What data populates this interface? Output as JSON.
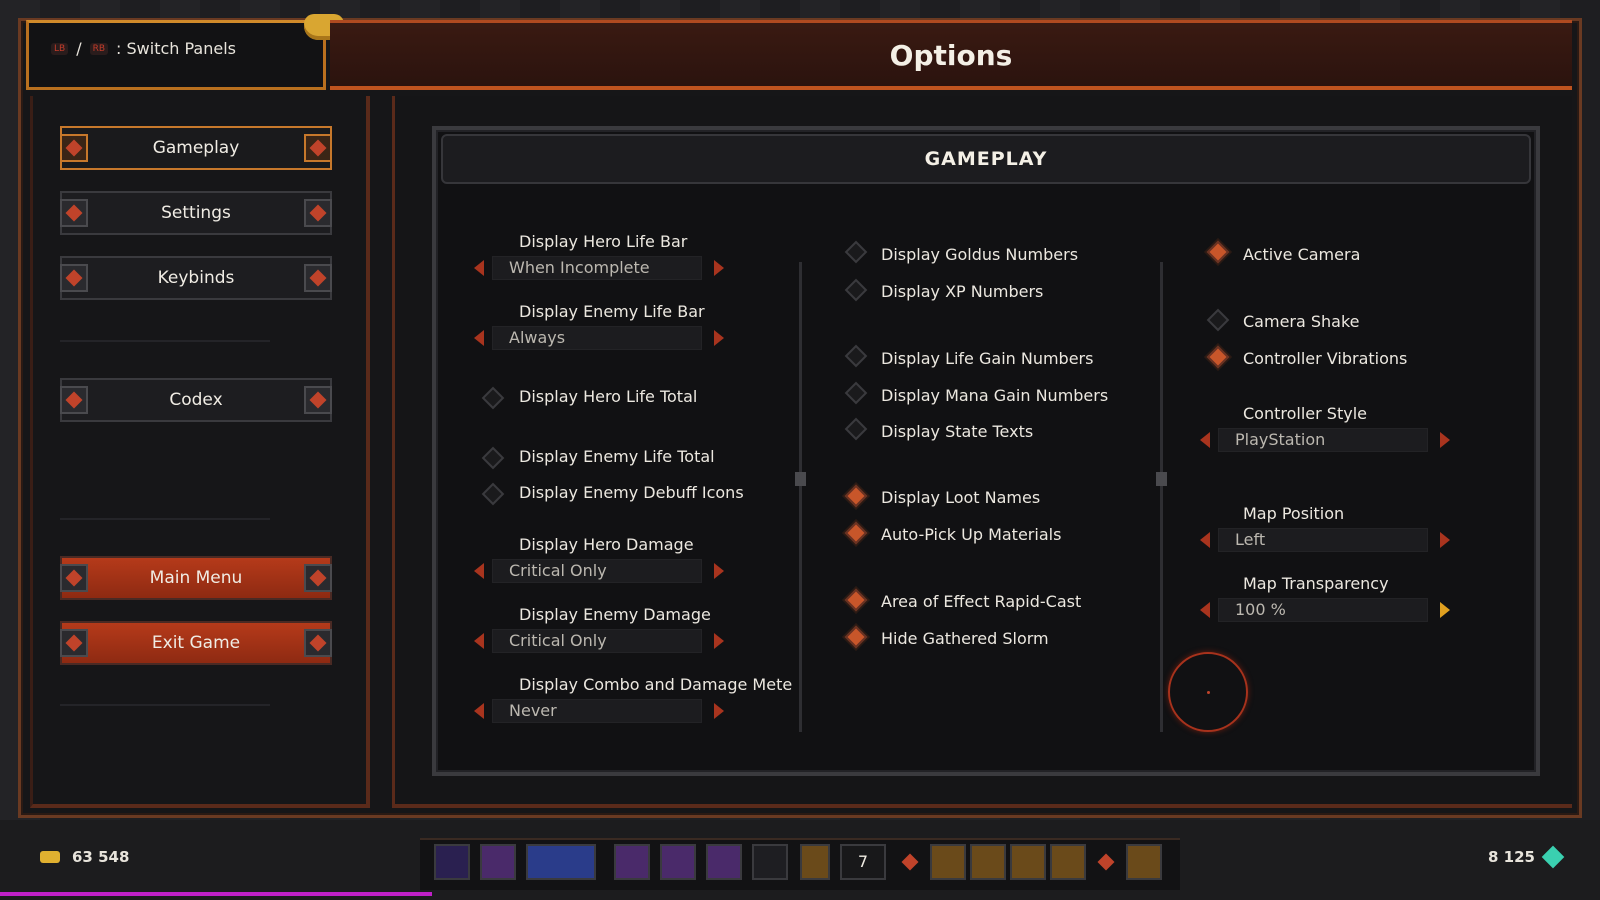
{
  "header": {
    "switch_glyph_left": "LB",
    "switch_separator": "/",
    "switch_glyph_right": "RB",
    "switch_text": ": Switch Panels",
    "title": "Options"
  },
  "sidebar": {
    "items": [
      {
        "label": "Gameplay",
        "active": true
      },
      {
        "label": "Settings",
        "active": false
      },
      {
        "label": "Keybinds",
        "active": false
      },
      {
        "label": "Codex",
        "active": false
      },
      {
        "label": "Main Menu",
        "active": false
      },
      {
        "label": "Exit Game",
        "active": false
      }
    ]
  },
  "section": {
    "title": "GAMEPLAY"
  },
  "column1": {
    "hero_life_bar": {
      "label": "Display Hero Life Bar",
      "value": "When Incomplete"
    },
    "enemy_life_bar": {
      "label": "Display Enemy Life Bar",
      "value": "Always"
    },
    "hero_life_total": {
      "label": "Display Hero Life Total",
      "checked": false
    },
    "enemy_life_total": {
      "label": "Display Enemy Life Total",
      "checked": false
    },
    "enemy_debuff_icons": {
      "label": "Display Enemy Debuff Icons",
      "checked": false
    },
    "hero_damage": {
      "label": "Display Hero Damage",
      "value": "Critical Only"
    },
    "enemy_damage": {
      "label": "Display Enemy Damage",
      "value": "Critical Only"
    },
    "combo_meter": {
      "label": "Display Combo and Damage Mete",
      "value": "Never"
    }
  },
  "column2": {
    "goldus_numbers": {
      "label": "Display Goldus Numbers",
      "checked": false
    },
    "xp_numbers": {
      "label": "Display XP Numbers",
      "checked": false
    },
    "life_gain_numbers": {
      "label": "Display Life Gain Numbers",
      "checked": false
    },
    "mana_gain_numbers": {
      "label": "Display Mana Gain Numbers",
      "checked": false
    },
    "state_texts": {
      "label": "Display State Texts",
      "checked": false
    },
    "loot_names": {
      "label": "Display Loot Names",
      "checked": true
    },
    "auto_pickup": {
      "label": "Auto-Pick Up Materials",
      "checked": true
    },
    "aoe_rapid_cast": {
      "label": "Area of Effect Rapid-Cast",
      "checked": true
    },
    "hide_slorm": {
      "label": "Hide Gathered Slorm",
      "checked": true
    }
  },
  "column3": {
    "active_camera": {
      "label": "Active Camera",
      "checked": true
    },
    "camera_shake": {
      "label": "Camera Shake",
      "checked": false
    },
    "controller_vibrations": {
      "label": "Controller Vibrations",
      "checked": true
    },
    "controller_style": {
      "label": "Controller Style",
      "value": "PlayStation"
    },
    "map_position": {
      "label": "Map Position",
      "value": "Left"
    },
    "map_transparency": {
      "label": "Map Transparency",
      "value": "100 %"
    }
  },
  "footer": {
    "gold": "63 548",
    "gems": "8 125",
    "potion_count": "7",
    "xp_progress": 0.27
  },
  "colors": {
    "accent": "#c0541f",
    "danger_button": "#b53a1a",
    "checked": "#c8562a",
    "xp_bar": "#c020c8"
  }
}
